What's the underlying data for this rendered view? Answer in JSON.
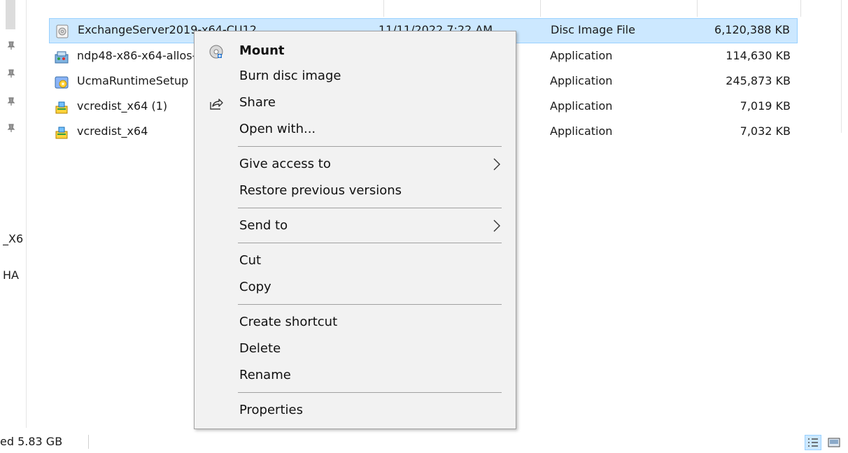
{
  "sidebar": {
    "partial_labels": [
      "_X6",
      "HA"
    ]
  },
  "files": [
    {
      "name": "ExchangeServer2019-x64-CU12",
      "date": "11/11/2022 7:22 AM",
      "type": "Disc Image File",
      "size": "6,120,388 KB",
      "icon": "disc-image-icon",
      "selected": true
    },
    {
      "name": "ndp48-x86-x64-allos-enu",
      "date": "",
      "type": "Application",
      "size": "114,630 KB",
      "icon": "installer-icon",
      "selected": false
    },
    {
      "name": "UcmaRuntimeSetup",
      "date": "",
      "type": "Application",
      "size": "245,873 KB",
      "icon": "setup-icon",
      "selected": false
    },
    {
      "name": "vcredist_x64 (1)",
      "date": "",
      "type": "Application",
      "size": "7,019 KB",
      "icon": "vcredist-icon",
      "selected": false
    },
    {
      "name": "vcredist_x64",
      "date": "",
      "type": "Application",
      "size": "7,032 KB",
      "icon": "vcredist-icon",
      "selected": false
    }
  ],
  "row_date_suffix": "M",
  "context_menu": {
    "items": [
      {
        "label": "Mount",
        "bold": true,
        "icon": "mount-disc-icon"
      },
      {
        "label": "Burn disc image"
      },
      {
        "label": "Share",
        "icon": "share-icon"
      },
      {
        "label": "Open with..."
      },
      {
        "label": "Give access to",
        "submenu": true
      },
      {
        "label": "Restore previous versions"
      },
      {
        "label": "Send to",
        "submenu": true
      },
      {
        "label": "Cut"
      },
      {
        "label": "Copy"
      },
      {
        "label": "Create shortcut"
      },
      {
        "label": "Delete"
      },
      {
        "label": "Rename"
      },
      {
        "label": "Properties"
      }
    ]
  },
  "status_bar": {
    "text": "ed  5.83 GB"
  },
  "colors": {
    "selection": "#cce8ff",
    "selection_border": "#99d1ff",
    "menu_bg": "#f2f2f2"
  }
}
